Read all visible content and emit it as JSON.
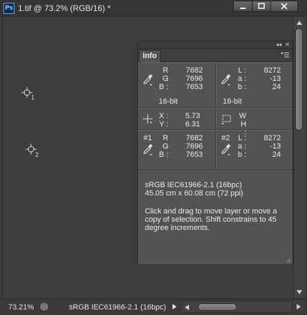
{
  "window": {
    "app_icon_text": "Ps",
    "title": "1.tif @ 73.2% (RGB/16) *"
  },
  "canvas": {
    "markers": [
      {
        "label": "1"
      },
      {
        "label": "2"
      }
    ]
  },
  "panel": {
    "tab_label": "Info",
    "collapse_glyph": "◂◂",
    "close_glyph": "✕",
    "color1": {
      "channels": [
        {
          "label": "R :",
          "value": "7682"
        },
        {
          "label": "G :",
          "value": "7696"
        },
        {
          "label": "B :",
          "value": "7653"
        }
      ],
      "bitdepth": "16-bit"
    },
    "color2": {
      "channels": [
        {
          "label": "L :",
          "value": "8272"
        },
        {
          "label": "a :",
          "value": "-13"
        },
        {
          "label": "b :",
          "value": "24"
        }
      ],
      "bitdepth": "16-bit"
    },
    "position": {
      "x_label": "X :",
      "x_value": "5.73",
      "y_label": "Y :",
      "y_value": "6.31"
    },
    "size": {
      "w_label": "W :",
      "w_value": "",
      "h_label": "H :",
      "h_value": ""
    },
    "sampler1": {
      "slot": "#1",
      "channels": [
        {
          "label": "R :",
          "value": "7682"
        },
        {
          "label": "G :",
          "value": "7696"
        },
        {
          "label": "B :",
          "value": "7653"
        }
      ]
    },
    "sampler2": {
      "slot": "#2",
      "channels": [
        {
          "label": "L :",
          "value": "8272"
        },
        {
          "label": "a :",
          "value": "-13"
        },
        {
          "label": "b :",
          "value": "24"
        }
      ]
    },
    "doc_profile": "sRGB IEC61966-2.1 (16bpc)",
    "doc_dimensions": "45.05 cm x 60.08 cm (72 ppi)",
    "hint": "Click and drag to move layer or move a copy of selection. Shift constrains to 45 degree increments."
  },
  "statusbar": {
    "zoom": "73.21%",
    "info": "sRGB IEC61966-2.1 (16bpc)"
  },
  "colors": {
    "window_bg": "#3c3c3c",
    "panel_bg": "#535353",
    "text": "#ececec"
  }
}
